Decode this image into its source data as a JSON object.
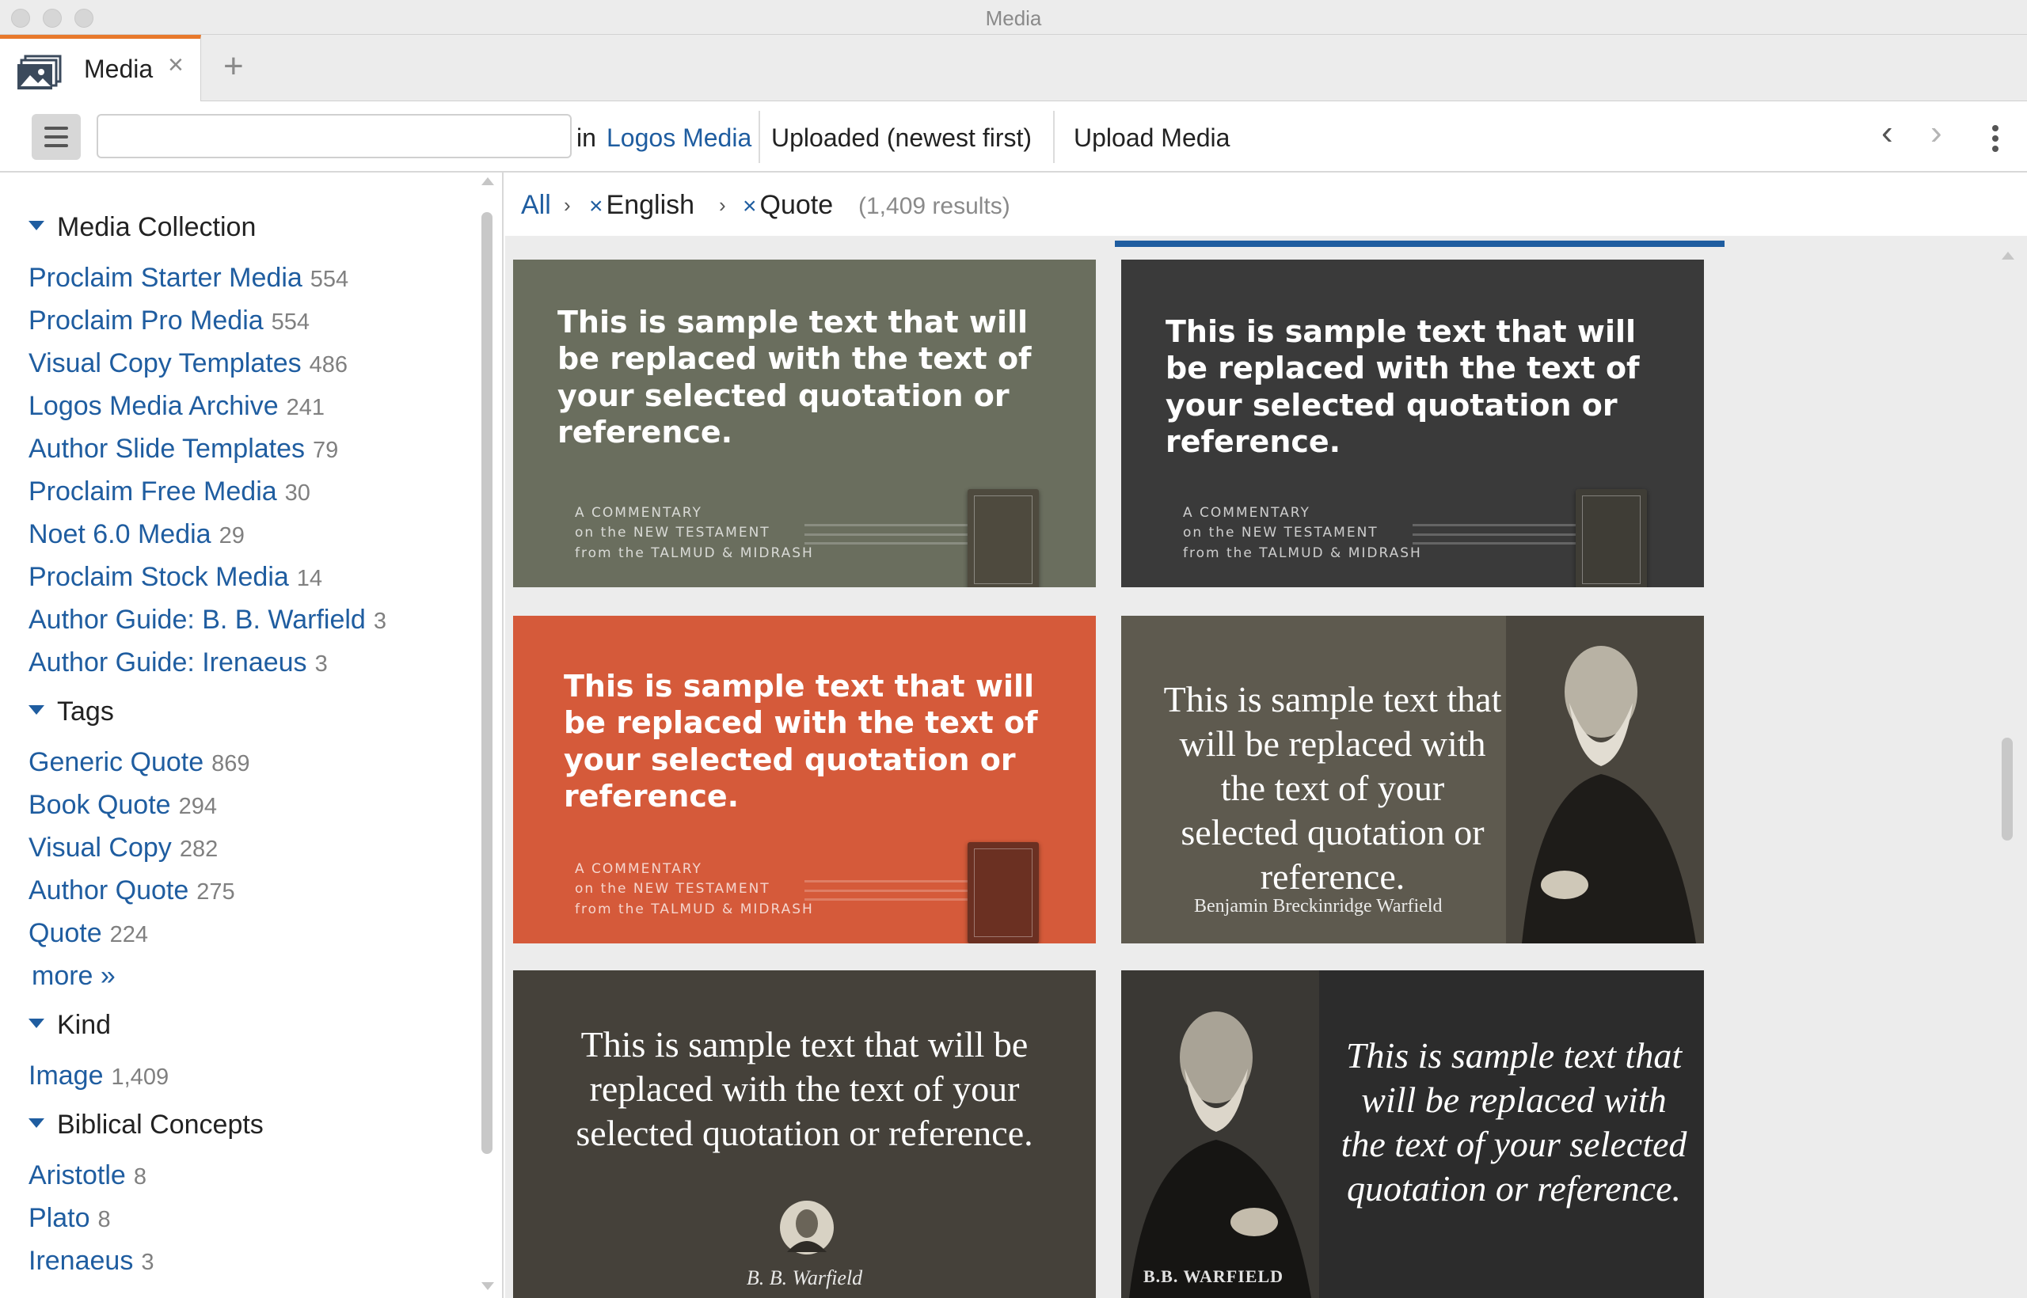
{
  "window": {
    "title": "Media"
  },
  "tabs": [
    {
      "label": "Media",
      "close": "×"
    }
  ],
  "new_tab": "+",
  "toolbar": {
    "search_value": "",
    "in_label": "in",
    "scope": "Logos Media",
    "sort": "Uploaded (newest first)",
    "upload": "Upload Media",
    "back": "‹",
    "forward": "›"
  },
  "sidebar": {
    "sections": [
      {
        "title": "Media Collection",
        "items": [
          {
            "label": "Proclaim Starter Media",
            "count": "554"
          },
          {
            "label": "Proclaim Pro Media",
            "count": "554"
          },
          {
            "label": "Visual Copy Templates",
            "count": "486"
          },
          {
            "label": "Logos Media Archive",
            "count": "241"
          },
          {
            "label": "Author Slide Templates",
            "count": "79"
          },
          {
            "label": "Proclaim Free Media",
            "count": "30"
          },
          {
            "label": "Noet 6.0 Media",
            "count": "29"
          },
          {
            "label": "Proclaim Stock Media",
            "count": "14"
          },
          {
            "label": "Author Guide: B. B. Warfield",
            "count": "3"
          },
          {
            "label": "Author Guide: Irenaeus",
            "count": "3"
          }
        ]
      },
      {
        "title": "Tags",
        "items": [
          {
            "label": "Generic Quote",
            "count": "869"
          },
          {
            "label": "Book Quote",
            "count": "294"
          },
          {
            "label": "Visual Copy",
            "count": "282"
          },
          {
            "label": "Author Quote",
            "count": "275"
          },
          {
            "label": "Quote",
            "count": "224"
          }
        ],
        "more": "more »"
      },
      {
        "title": "Kind",
        "items": [
          {
            "label": "Image",
            "count": "1,409"
          }
        ]
      },
      {
        "title": "Biblical Concepts",
        "items": [
          {
            "label": "Aristotle",
            "count": "8"
          },
          {
            "label": "Plato",
            "count": "8"
          },
          {
            "label": "Irenaeus",
            "count": "3"
          }
        ]
      }
    ]
  },
  "filters": {
    "all": "All",
    "sep": "›",
    "remove": "×",
    "chips": [
      "English",
      "Quote"
    ],
    "results": "(1,409 results)"
  },
  "tiles": [
    {
      "text": "This is sample text that will be replaced with the text of your selected quotation or reference.",
      "commentary": [
        "A COMMENTARY",
        "on the NEW TESTAMENT",
        "from the TALMUD & MIDRASH"
      ],
      "bg": "#6a6e5e"
    },
    {
      "text": "This is sample text that will be replaced with the text of your selected quotation or reference.",
      "commentary": [
        "A COMMENTARY",
        "on the NEW TESTAMENT",
        "from the TALMUD & MIDRASH"
      ],
      "bg": "#3a3a3a"
    },
    {
      "text": "This is sample text that will be replaced with the text of your selected quotation or reference.",
      "commentary": [
        "A COMMENTARY",
        "on the NEW TESTAMENT",
        "from the TALMUD & MIDRASH"
      ],
      "bg": "#d55a3a"
    },
    {
      "text": "This is sample text that will be replaced with the text of your selected quotation or reference.",
      "author": "Benjamin Breckinridge Warfield",
      "bg": "#5e5a4f"
    },
    {
      "text": "This is sample text that will be replaced with the text of your selected quotation or reference.",
      "author": "B. B. Warfield",
      "bg": "#45413a"
    },
    {
      "text": "This is sample text that will be replaced with the text of your selected quotation or reference.",
      "author": "B.B. WARFIELD",
      "bg": "#2c2c2c"
    }
  ],
  "colors": {
    "accent_tab": "#e8792b",
    "link": "#1f5da0",
    "progress": "#1f5da0"
  }
}
